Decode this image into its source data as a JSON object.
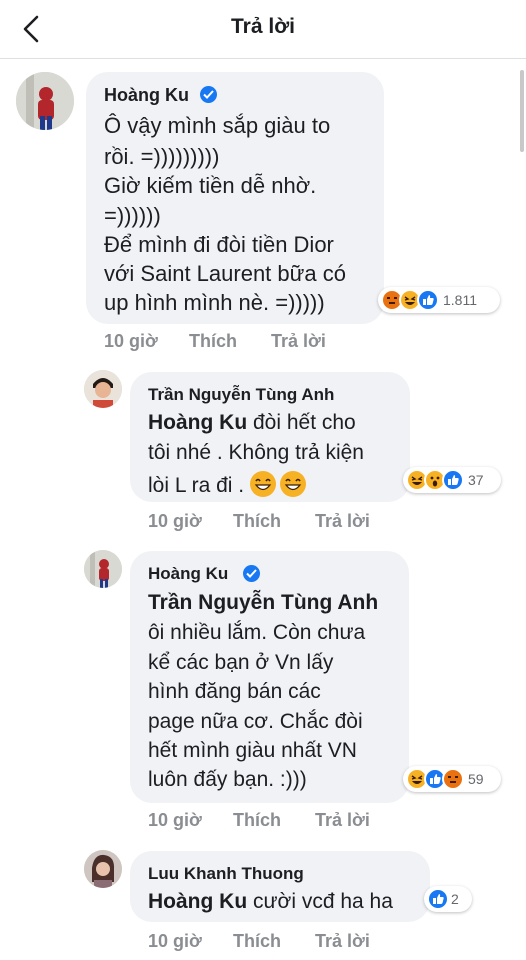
{
  "header": {
    "title": "Trả lời"
  },
  "comments": [
    {
      "author": "Hoàng Ku",
      "verified": true,
      "lines": [
        "Ô vậy mình sắp giàu to",
        "rồi. =)))))))))",
        "Giờ kiếm tiền dễ nhờ.",
        "=))))))",
        "Để mình đi đòi tiền Dior",
        "với Saint Laurent bữa có",
        "up hình mình nè. =)))))"
      ],
      "reactions": [
        "angry",
        "haha",
        "like"
      ],
      "reaction_count": "1.811",
      "time": "10 giờ",
      "like_label": "Thích",
      "reply_label": "Trả lời"
    },
    {
      "author": "Trần Nguyễn Tùng Anh",
      "verified": false,
      "mention": "Hoàng Ku",
      "lines": [
        " đòi hết cho",
        "tôi nhé . Không trả kiện",
        "lòi L ra đi . "
      ],
      "reactions": [
        "haha",
        "wow",
        "like"
      ],
      "reaction_count": "37",
      "time": "10 giờ",
      "like_label": "Thích",
      "reply_label": "Trả lời"
    },
    {
      "author": "Hoàng Ku",
      "verified": true,
      "mention": "Trần Nguyễn Tùng Anh",
      "lines": [
        "ôi nhiều lắm. Còn chưa",
        "kể các bạn ở Vn lấy",
        "hình đăng bán các",
        "page nữa cơ. Chắc đòi",
        "hết mình giàu nhất VN",
        "luôn đấy bạn. :)))"
      ],
      "reactions": [
        "haha",
        "like",
        "angry"
      ],
      "reaction_count": "59",
      "time": "10 giờ",
      "like_label": "Thích",
      "reply_label": "Trả lời"
    },
    {
      "author": "Luu Khanh Thuong",
      "verified": false,
      "mention": "Hoàng Ku",
      "lines": [
        " cười vcđ ha ha"
      ],
      "reactions": [
        "like"
      ],
      "reaction_count": "2",
      "time": "10 giờ",
      "like_label": "Thích",
      "reply_label": "Trả lời"
    }
  ],
  "colors": {
    "bubble": "#f0f2f5",
    "like": "#1877f2",
    "meta": "#8a8d91"
  }
}
